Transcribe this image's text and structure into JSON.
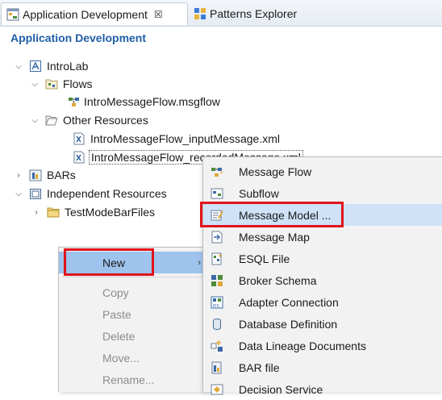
{
  "tabs": [
    {
      "label": "Application Development",
      "close": "☒"
    },
    {
      "label": "Patterns Explorer"
    }
  ],
  "panel": {
    "title": "Application Development"
  },
  "tree": {
    "introlab": "IntroLab",
    "flows": "Flows",
    "msgflow": "IntroMessageFlow.msgflow",
    "other_resources": "Other Resources",
    "input_message": "IntroMessageFlow_inputMessage.xml",
    "recorded_message": "IntroMessageFlow_recordedMessage.xml",
    "bars": "BARs",
    "independent_resources": "Independent Resources",
    "testmode": "TestModeBarFiles"
  },
  "context_menu": {
    "new": "New",
    "copy": "Copy",
    "paste": "Paste",
    "delete": "Delete",
    "move": "Move...",
    "rename": "Rename..."
  },
  "submenu": [
    {
      "label": "Message Flow",
      "icon": "message-flow-icon"
    },
    {
      "label": "Subflow",
      "icon": "subflow-icon"
    },
    {
      "label": "Message Model ...",
      "icon": "message-model-icon"
    },
    {
      "label": "Message Map",
      "icon": "message-map-icon"
    },
    {
      "label": "ESQL File",
      "icon": "esql-file-icon"
    },
    {
      "label": "Broker Schema",
      "icon": "broker-schema-icon"
    },
    {
      "label": "Adapter Connection",
      "icon": "adapter-connection-icon"
    },
    {
      "label": "Database Definition",
      "icon": "database-definition-icon"
    },
    {
      "label": "Data Lineage Documents",
      "icon": "data-lineage-icon"
    },
    {
      "label": "BAR file",
      "icon": "bar-file-icon"
    },
    {
      "label": "Decision Service",
      "icon": "decision-service-icon"
    }
  ],
  "colors": {
    "highlight_box": "#e0141c",
    "menu_selected": "#9ec3ec",
    "title": "#1f5fa8"
  }
}
